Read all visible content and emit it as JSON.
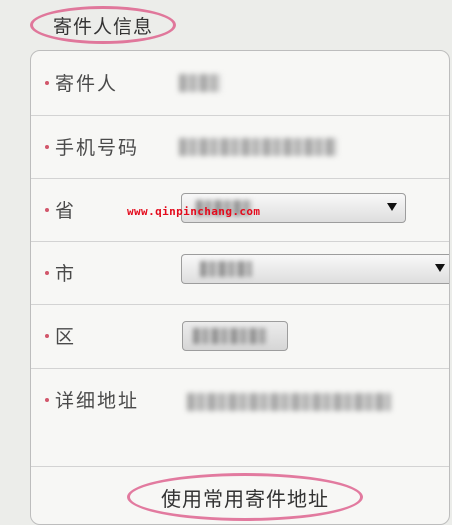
{
  "section": {
    "title": "寄件人信息"
  },
  "form": {
    "name": {
      "label": "寄件人"
    },
    "phone": {
      "label": "手机号码"
    },
    "province": {
      "label": "省"
    },
    "city": {
      "label": "市"
    },
    "district": {
      "label": "区"
    },
    "address": {
      "label": "详细地址"
    }
  },
  "watermark": {
    "text": "www.qinpinchang.com"
  },
  "actions": {
    "use_common_address": "使用常用寄件地址"
  },
  "colors": {
    "accent_pink": "#e0779b",
    "required_dot": "#d2566b",
    "watermark_red": "#e40b1d"
  }
}
